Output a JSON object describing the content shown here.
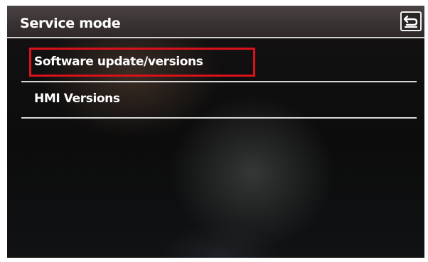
{
  "header": {
    "title": "Service mode",
    "back_icon": "back-arrow-icon"
  },
  "menu": {
    "items": [
      {
        "label": "Software update/versions",
        "highlighted": true
      },
      {
        "label": "HMI Versions",
        "highlighted": false
      }
    ]
  },
  "colors": {
    "highlight": "#d8121a",
    "text": "#ffffff",
    "header_bg": "#3a3333"
  }
}
